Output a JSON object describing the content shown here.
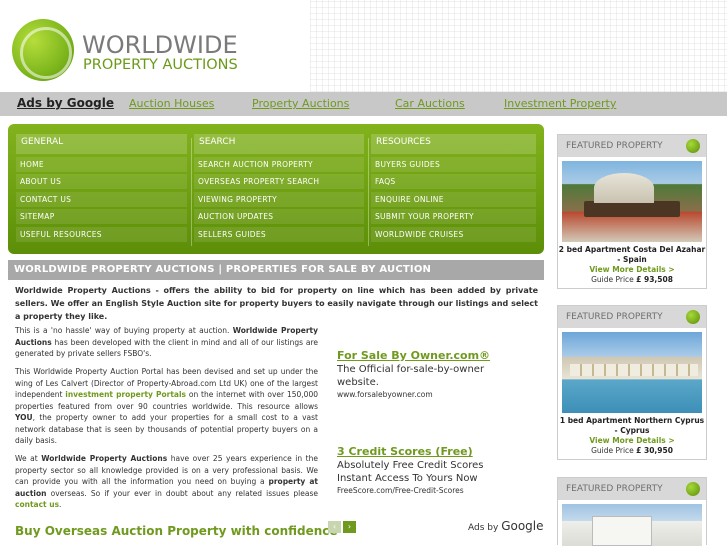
{
  "logo": {
    "line1": "WORLDWIDE",
    "line2": "PROPERTY AUCTIONS"
  },
  "adbar": {
    "ads_label": "Ads by Google",
    "links": [
      "Auction Houses",
      "Property Auctions",
      "Car Auctions",
      "Investment Property"
    ]
  },
  "nav": {
    "general": {
      "heading": "GENERAL",
      "items": [
        "HOME",
        "ABOUT US",
        "CONTACT US",
        "SITEMAP",
        "USEFUL RESOURCES"
      ]
    },
    "search": {
      "heading": "SEARCH",
      "items": [
        "SEARCH AUCTION PROPERTY",
        "OVERSEAS PROPERTY SEARCH",
        "VIEWING PROPERTY",
        "AUCTION UPDATES",
        "SELLERS GUIDES"
      ]
    },
    "resources": {
      "heading": "RESOURCES",
      "items": [
        "BUYERS GUIDES",
        "FAQS",
        "ENQUIRE ONLINE",
        "SUBMIT YOUR PROPERTY",
        "WORLDWIDE CRUISES"
      ]
    }
  },
  "main": {
    "title": "WORLDWIDE PROPERTY AUCTIONS | PROPERTIES FOR SALE BY AUCTION",
    "intro": "Worldwide Property Auctions - offers the ability to bid for property on line which has been added by private sellers. We offer an English Style Auction site for property buyers to easily navigate through our listings and select a property they like.",
    "p1_a": "This is a 'no hassle' way of buying property at auction. ",
    "p1_b": "Worldwide Property Auctions",
    "p1_c": " has been developed with the client in mind and all of our listings are generated by private sellers FSBO's.",
    "p2_a": "This Worldwide Property Auction Portal has been devised and set up under the wing of Les Calvert (Director of Property-Abroad.com Ltd UK) one of the largest independent ",
    "p2_link": "investment property Portals",
    "p2_b": " on the internet with over 150,000 properties featured from over 90 countries worldwide. This resource allows ",
    "p2_you": "YOU",
    "p2_c": ", the property owner to add your properties for a small cost to a vast network database that is seen by thousands of potential property buyers on a daily basis.",
    "p3_a": "We at ",
    "p3_b": "Worldwide Property Auctions",
    "p3_c": " have over 25 years experience in the property sector so all knowledge provided is on a very professional basis. We can provide you with all the information you need on buying a ",
    "p3_d": "property  at auction",
    "p3_e": " overseas. So if your ever in doubt about any related issues please ",
    "p3_link": "contact us",
    "p3_end": ".",
    "bottom_heading": "Buy Overseas Auction Property with confidence"
  },
  "ads": [
    {
      "title": "For Sale By Owner.com®",
      "line1": "The Official for-sale-by-owner",
      "line2": "website.",
      "url": "www.forsalebyowner.com"
    },
    {
      "title": "3 Credit Scores (Free)",
      "line1": "Absolutely Free Credit Scores",
      "line2": "Instant Access To Yours Now",
      "url": "FreeScore.com/Free-Credit-Scores"
    }
  ],
  "ads_by": {
    "prefix": "Ads by",
    "brand": "Google"
  },
  "arrows": {
    "prev": "‹",
    "next": "›"
  },
  "featured": [
    {
      "heading": "FEATURED PROPERTY",
      "title": "2 bed Apartment Costa Del Azahar - Spain",
      "more": "View More Details >",
      "price_label": "Guide Price ",
      "price": "£ 93,508"
    },
    {
      "heading": "FEATURED PROPERTY",
      "title": "1 bed Apartment Northern Cyprus - Cyprus",
      "more": "View More Details >",
      "price_label": "Guide Price ",
      "price": "£ 30,950"
    },
    {
      "heading": "FEATURED PROPERTY"
    }
  ]
}
